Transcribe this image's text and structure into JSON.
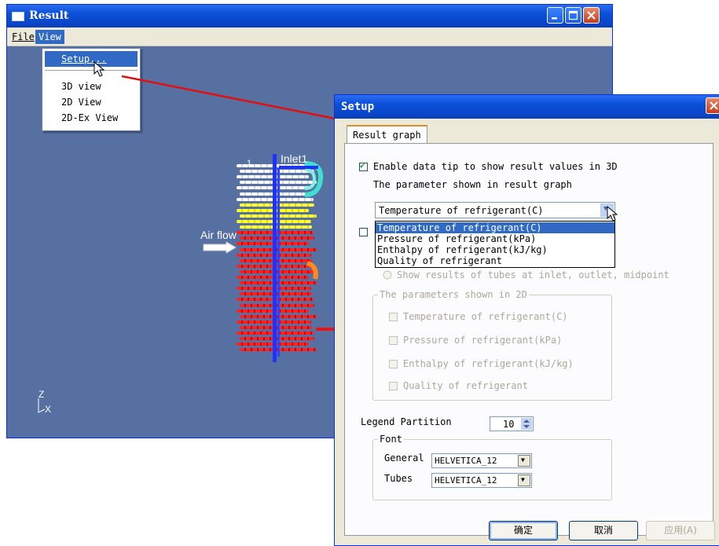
{
  "result_window": {
    "title": "Result",
    "menu": {
      "file": "File",
      "view": "View"
    },
    "view_menu": [
      "Setup...",
      "3D view",
      "2D View",
      "2D-Ex View"
    ]
  },
  "scene": {
    "inlet_label": "Inlet1",
    "air_flow_label": "Air flow",
    "tube_number": "1",
    "axes": {
      "z": "Z",
      "x": "X"
    }
  },
  "setup_dialog": {
    "title": "Setup",
    "tab": "Result graph",
    "enable_data_tip": {
      "label": "Enable data tip to show result values in 3D",
      "checked": true
    },
    "param_heading": "The parameter shown in result graph",
    "combo_value": "Temperature of refrigerant(C)",
    "combo_options": [
      "Temperature of refrigerant(C)",
      "Pressure of refrigerant(kPa)",
      "Enthalpy of refrigerant(kJ/kg)",
      "Quality of refrigerant"
    ],
    "radio_tubes": "Show results of  tubes at inlet, outlet, midpoint",
    "params_2d": {
      "title": "The parameters shown in 2D",
      "items": [
        "Temperature of refrigerant(C)",
        "Pressure of refrigerant(kPa)",
        "Enthalpy of refrigerant(kJ/kg)",
        "Quality of refrigerant"
      ]
    },
    "legend_partition": {
      "label": "Legend Partition",
      "value": "10"
    },
    "font": {
      "title": "Font",
      "general_label": "General",
      "general_value": "HELVETICA_12",
      "tubes_label": "Tubes",
      "tubes_value": "HELVETICA_12"
    },
    "buttons": {
      "ok": "确定",
      "cancel": "取消",
      "apply": "应用(A)"
    }
  }
}
